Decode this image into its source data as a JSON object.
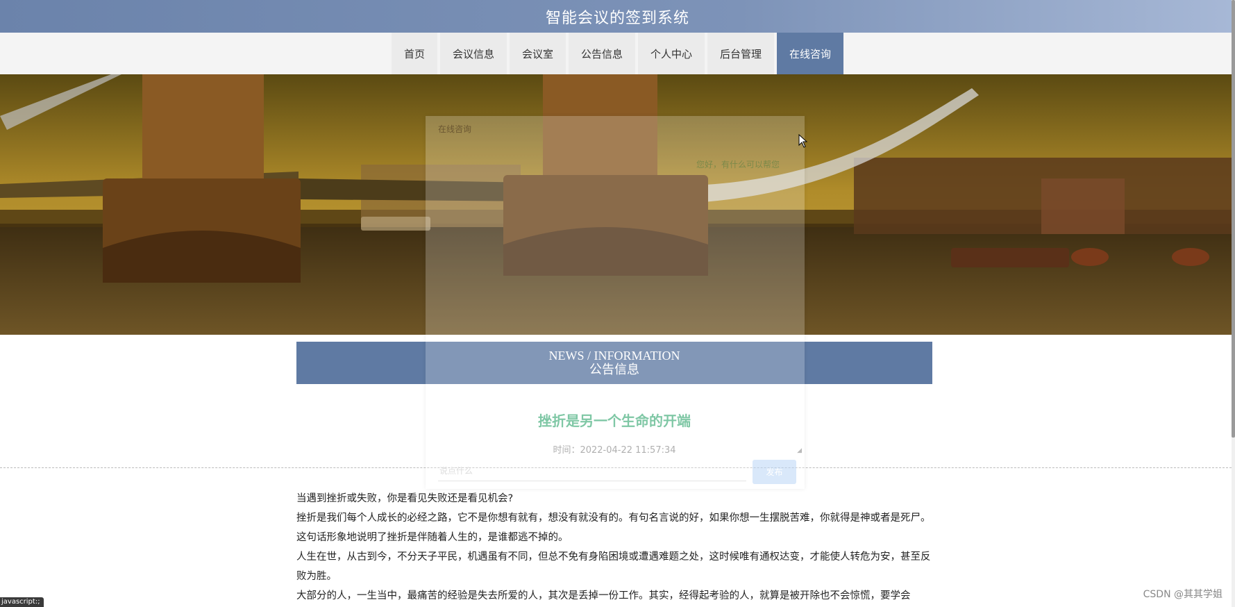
{
  "site_title": "智能会议的签到系统",
  "nav": {
    "items": [
      {
        "label": "首页"
      },
      {
        "label": "会议信息"
      },
      {
        "label": "会议室"
      },
      {
        "label": "公告信息"
      },
      {
        "label": "个人中心"
      },
      {
        "label": "后台管理"
      },
      {
        "label": "在线咨询"
      }
    ],
    "active_index": 6
  },
  "news": {
    "heading_en": "NEWS / INFORMATION",
    "heading_cn": "公告信息"
  },
  "article": {
    "title": "挫折是另一个生命的开端",
    "time": "时间：2022-04-22 11:57:34",
    "paragraphs": [
      "当遇到挫折或失败，你是看见失败还是看见机会?",
      "挫折是我们每个人成长的必经之路，它不是你想有就有，想没有就没有的。有句名言说的好，如果你想一生摆脱苦难，你就得是神或者是死尸。这句话形象地说明了挫折是伴随着人生的，是谁都逃不掉的。",
      "人生在世，从古到今，不分天子平民，机遇虽有不同，但总不免有身陷困境或遭遇难题之处，这时候唯有通权达变，才能使人转危为安，甚至反败为胜。",
      "大部分的人，一生当中，最痛苦的经验是失去所爱的人，其次是丢掉一份工作。其实，经得起考验的人，就算是被开除也不会惊慌，要学会"
    ]
  },
  "chat": {
    "title": "在线咨询",
    "greeting": "您好，有什么可以帮您",
    "input_placeholder": "说点什么",
    "send_label": "发布",
    "resize_glyph": "◢"
  },
  "status_bar": "javascript:;",
  "watermark": "CSDN @其其学姐",
  "colors": {
    "header": "#7d93b8",
    "accent": "#5f7aa3",
    "title_green": "#5bb88c"
  }
}
